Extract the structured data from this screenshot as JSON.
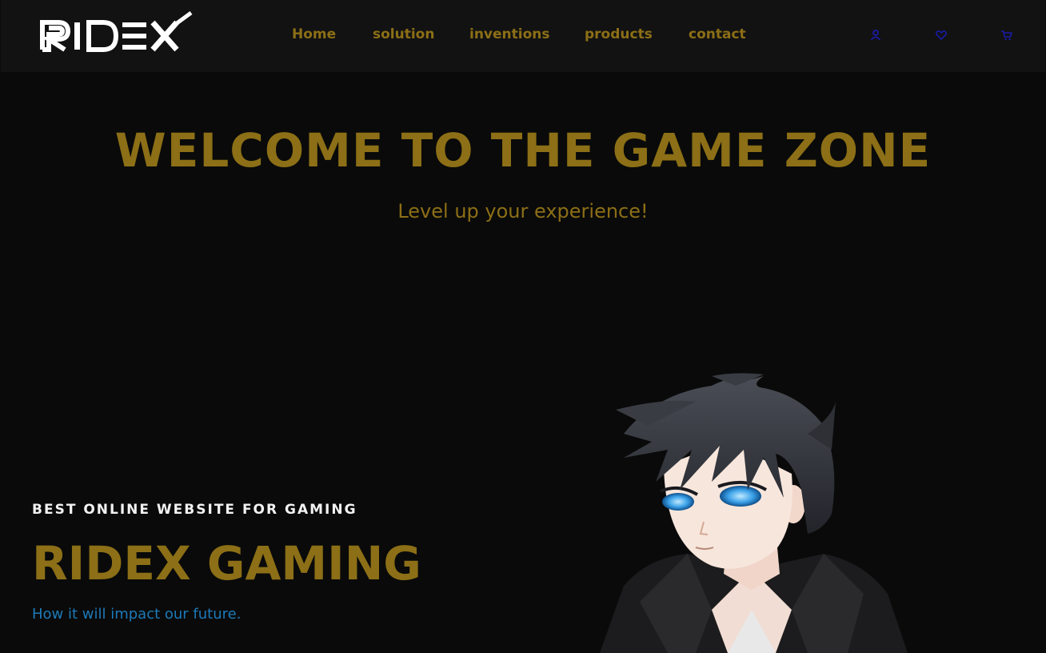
{
  "header": {
    "logo_text": "RIDEX",
    "nav": [
      {
        "label": "Home"
      },
      {
        "label": "solution"
      },
      {
        "label": "inventions"
      },
      {
        "label": "products"
      },
      {
        "label": "contact"
      }
    ],
    "icons": [
      "user-icon",
      "heart-icon",
      "cart-icon"
    ]
  },
  "hero": {
    "title": "WELCOME TO THE GAME ZONE",
    "subtitle": "Level up your experience!"
  },
  "feature": {
    "eyebrow": "BEST ONLINE WEBSITE FOR GAMING",
    "heading": "RIDEX GAMING",
    "tagline": "How it will impact our future."
  },
  "colors": {
    "background": "#0a0a0a",
    "header_bg": "#121212",
    "accent_gold": "#8c6f16",
    "link_blue": "#1d7ab8",
    "icon_blue": "#1a1aa6"
  }
}
